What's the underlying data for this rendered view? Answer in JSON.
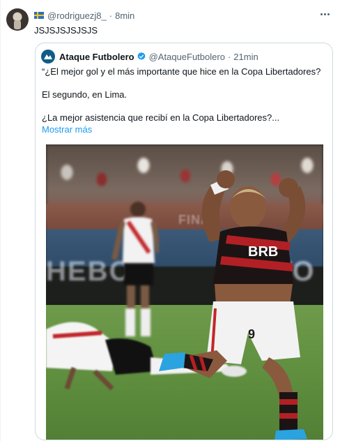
{
  "tweet": {
    "handle": "@rodriguezj8_",
    "separator": "·",
    "time": "8min",
    "text": "JSJSJSJSJSJS",
    "flag_icon": "sweden-flag-icon",
    "more_icon": "more-options-icon"
  },
  "quote": {
    "name": "Ataque Futbolero",
    "verified_icon": "verified-badge-icon",
    "handle": "@AtaqueFutbolero",
    "separator": "·",
    "time": "21min",
    "lines": [
      "“¿El mejor gol y el más importante que hice en la Copa Libertadores?",
      "El segundo, en Lima.",
      "¿La mejor asistencia que recibí en la Copa Libertadores?..."
    ],
    "show_more": "Mostrar más",
    "image_alt_subject": "flamengo-player-celebration-photo",
    "jersey_number": "9",
    "sponsor_text": "BRB",
    "banner_left": "HEBO",
    "banner_mid": "FINAL",
    "banner_right": "EVO"
  },
  "colors": {
    "link": "#1d9bf0",
    "muted": "#536471",
    "verified": "#1d9bf0",
    "border": "#cfd9de"
  }
}
